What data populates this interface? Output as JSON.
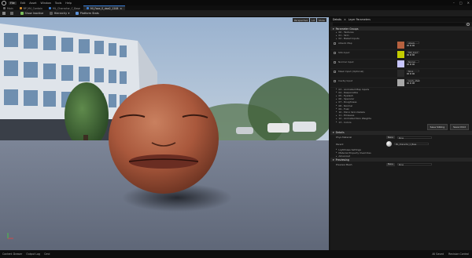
{
  "menu": [
    "File",
    "Edit",
    "Asset",
    "Window",
    "Tools",
    "Help"
  ],
  "tabs": [
    {
      "label": "Main",
      "color": "gray"
    },
    {
      "label": "BP_M4_Contain",
      "color": "orange"
    },
    {
      "label": "ML_Charactor_C_Base",
      "color": "blue"
    },
    {
      "label": "MI_Face_S_dae2_1208",
      "color": "blue",
      "active": true
    }
  ],
  "toolbar": [
    {
      "label": "Save",
      "icon": "save-icon"
    },
    {
      "label": "Browse",
      "icon": "browse-icon"
    },
    {
      "label": "Show Inactive",
      "icon": "inactive-icon"
    },
    {
      "label": "Hierarchy",
      "icon": "hierarchy-icon"
    },
    {
      "label": "Platform Stats",
      "icon": "stats-icon"
    }
  ],
  "viewport": {
    "tools": [
      "Perspective",
      "Lit",
      "Show"
    ]
  },
  "panel": {
    "tabs": [
      "Details",
      "Layer Parameters"
    ],
    "sections": {
      "parameter_groups": "Parameter Groups",
      "details": "Details",
      "previewing": "Previewing"
    },
    "pre_rows": [
      "00 - Textures",
      "01 - Skin",
      "02 - Baked Inputs"
    ],
    "params": [
      {
        "name": "Albedo Map",
        "color": "#b7613f",
        "dd": "Albedo"
      },
      {
        "name": "SSS Input",
        "color": "#c4cc00",
        "dd": "SSS_Input"
      },
      {
        "name": "Normal Input",
        "color": "#c8c6ff",
        "dd": "Normal"
      },
      {
        "name": "Mask Input (Optional)",
        "color": "#2a2a2a",
        "dd": "None"
      },
      {
        "name": "Cavity Input",
        "color": "#a8a8a8",
        "dd": "Cavity_Mask"
      }
    ],
    "post_rows": [
      "03 - Animated Map Inputs",
      "04 - Responsible",
      "05 - Eyelash",
      "06 - Specular",
      "07 - Roughness",
      "08 - Normal",
      "09 - Fuzz",
      "10 - Micro Skin Details",
      "11 - Emissive",
      "12 - Animated Skin Weights",
      "13 - Colors"
    ],
    "buttons": [
      "Save Sibling",
      "Save Child"
    ],
    "details_rows": [
      {
        "label": "Phys Material",
        "tag": "None",
        "value": "None"
      },
      {
        "label": "Parent",
        "tag": "",
        "value": "ML_Charactor_C_Base"
      }
    ],
    "details_sub": [
      "Lightmass Settings",
      "Material Property Overrides",
      "Advanced"
    ],
    "previewing_rows": [
      {
        "label": "Preview Mesh",
        "tag": "None",
        "value": "None"
      }
    ]
  },
  "statusbar": {
    "left": [
      "Content Drawer",
      "Output Log",
      "Cmd"
    ],
    "right": [
      "All Saved",
      "Revision Control"
    ]
  }
}
